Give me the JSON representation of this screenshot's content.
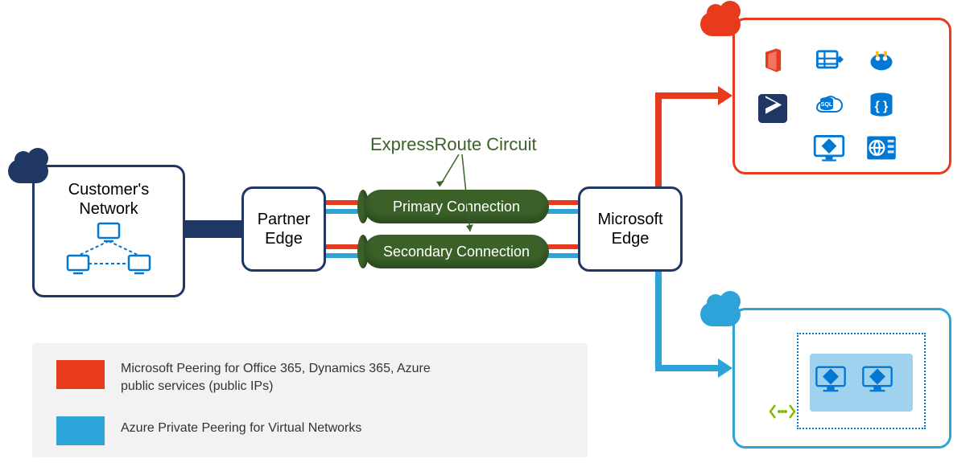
{
  "title_circuit": "ExpressRoute Circuit",
  "customer": {
    "title": "Customer's\nNetwork"
  },
  "partner": "Partner\nEdge",
  "msedge": "Microsoft\nEdge",
  "pipe_primary": "Primary Connection",
  "pipe_secondary": "Secondary Connection",
  "legend": {
    "red": "Microsoft Peering for Office 365, Dynamics 365, Azure public services (public IPs)",
    "blue": "Azure Private Peering for Virtual Networks"
  },
  "colors": {
    "navy": "#203764",
    "pipe": "#3b6129",
    "red": "#e83b1e",
    "blue": "#2ea3d9",
    "azure": "#0078d4"
  },
  "services_top": [
    "office",
    "storage",
    "hdinsight",
    "dynamics",
    "sql",
    "code",
    "vm",
    "web"
  ],
  "vnet_icons": [
    "vm-left",
    "vm-right"
  ]
}
